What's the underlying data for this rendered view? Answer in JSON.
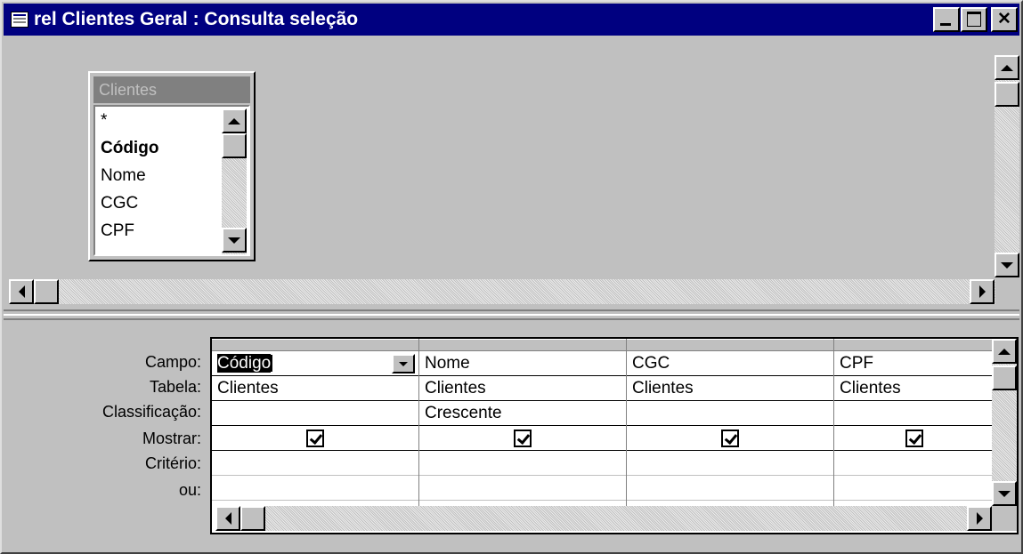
{
  "window": {
    "title": "rel Clientes Geral : Consulta seleção",
    "icon": "query-icon"
  },
  "field_list": {
    "title": "Clientes",
    "fields": [
      {
        "label": "*",
        "bold": false
      },
      {
        "label": "Código",
        "bold": true
      },
      {
        "label": "Nome",
        "bold": false
      },
      {
        "label": "CGC",
        "bold": false
      },
      {
        "label": "CPF",
        "bold": false
      }
    ]
  },
  "grid": {
    "row_labels": {
      "campo": "Campo:",
      "tabela": "Tabela:",
      "classificacao": "Classificação:",
      "mostrar": "Mostrar:",
      "criterio": "Critério:",
      "ou": "ou:"
    },
    "columns": [
      {
        "campo": "Código",
        "tabela": "Clientes",
        "classificacao": "",
        "mostrar": true
      },
      {
        "campo": "Nome",
        "tabela": "Clientes",
        "classificacao": "Crescente",
        "mostrar": true
      },
      {
        "campo": "CGC",
        "tabela": "Clientes",
        "classificacao": "",
        "mostrar": true
      },
      {
        "campo": "CPF",
        "tabela": "Clientes",
        "classificacao": "",
        "mostrar": true
      }
    ]
  }
}
